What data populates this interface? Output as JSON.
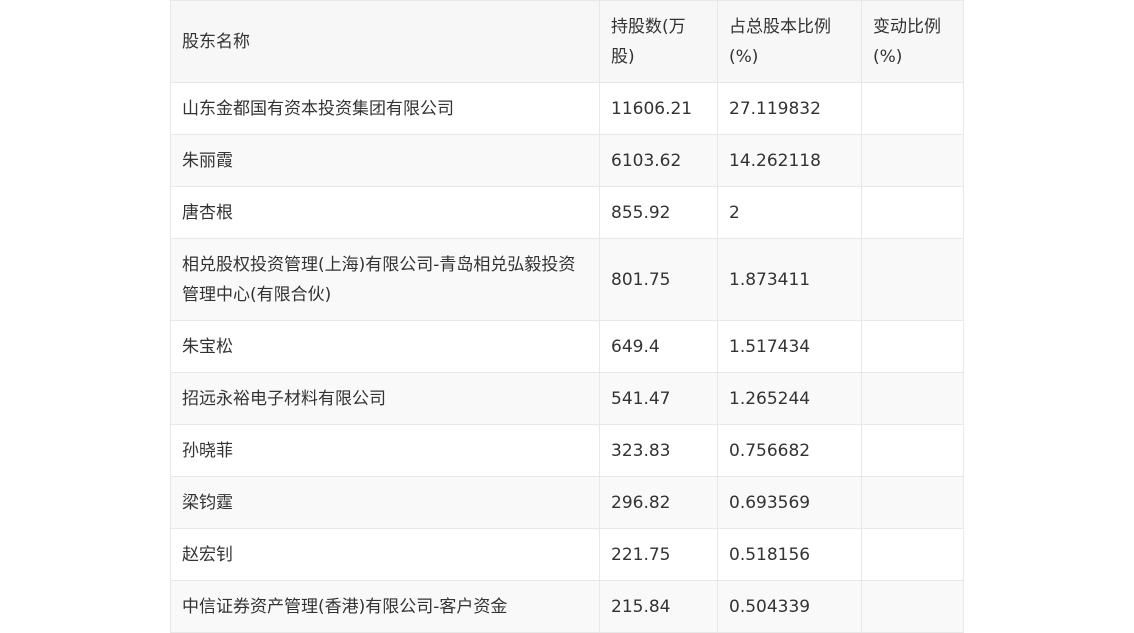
{
  "table": {
    "headers": [
      "股东名称",
      "持股数(万股)",
      "占总股本比例(%)",
      "变动比例(%)"
    ],
    "rows": [
      [
        "山东金都国有资本投资集团有限公司",
        "11606.21",
        "27.119832",
        ""
      ],
      [
        "朱丽霞",
        "6103.62",
        "14.262118",
        ""
      ],
      [
        "唐杏根",
        "855.92",
        "2",
        ""
      ],
      [
        "相兑股权投资管理(上海)有限公司-青岛相兑弘毅投资管理中心(有限合伙)",
        "801.75",
        "1.873411",
        ""
      ],
      [
        "朱宝松",
        "649.4",
        "1.517434",
        ""
      ],
      [
        "招远永裕电子材料有限公司",
        "541.47",
        "1.265244",
        ""
      ],
      [
        "孙晓菲",
        "323.83",
        "0.756682",
        ""
      ],
      [
        "梁钧霆",
        "296.82",
        "0.693569",
        ""
      ],
      [
        "赵宏钊",
        "221.75",
        "0.518156",
        ""
      ],
      [
        "中信证券资产管理(香港)有限公司-客户资金",
        "215.84",
        "0.504339",
        ""
      ]
    ]
  }
}
